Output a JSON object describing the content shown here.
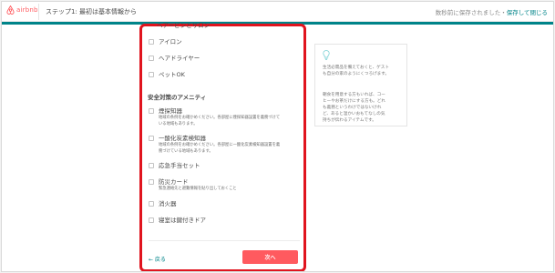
{
  "header": {
    "brand": "airbnb",
    "step_title": "ステップ1: 最初は基本情報から",
    "save_status": "数秒前に保存されました・",
    "save_link": "保存して閉じる",
    "progress_fraction": 1.0
  },
  "amenities": {
    "cut_item": "ヘアーピンとサロン",
    "items": [
      {
        "label": "アイロン"
      },
      {
        "label": "ヘアドライヤー"
      },
      {
        "label": "ペットOK"
      }
    ]
  },
  "safety": {
    "heading": "安全対策のアメニティ",
    "items": [
      {
        "label": "煙探知器",
        "desc1": "地域の条例をお確かめください。各部屋に煙探知器設置を義務づけて",
        "desc2": "いる地域もあります。"
      },
      {
        "label": "一酸化炭素検知器",
        "desc1": "地域の条例をお確かめください。各部屋に一酸化炭素検知器設置を義",
        "desc2": "務づけている地域もあります。"
      },
      {
        "label": "応急手当セット"
      },
      {
        "label": "防災カード",
        "desc1": "緊急連絡先と避難情報を貼り出しておくこと"
      },
      {
        "label": "消火器"
      },
      {
        "label": "寝室は鍵付きドア"
      }
    ]
  },
  "footer": {
    "back_label": "← 戻る",
    "next_label": "次へ"
  },
  "tip": {
    "icon": "lightbulb-icon",
    "p1_line1": "生活必需品を備えておくと、ゲスト",
    "p1_line2": "も自分の家のようにくつろげます。",
    "p2_line1": "朝食を用意する方もいれば、コー",
    "p2_line2": "ヒーやお茶だけにする方も。どれ",
    "p2_line3": "も義務というわけではないけれ",
    "p2_line4": "ど、あると温かいおもてなしの気",
    "p2_line5": "持ちが伝わるアイテムです。"
  },
  "colors": {
    "brand": "#ff5a5f",
    "accent": "#008489",
    "highlight": "#e0141e"
  }
}
